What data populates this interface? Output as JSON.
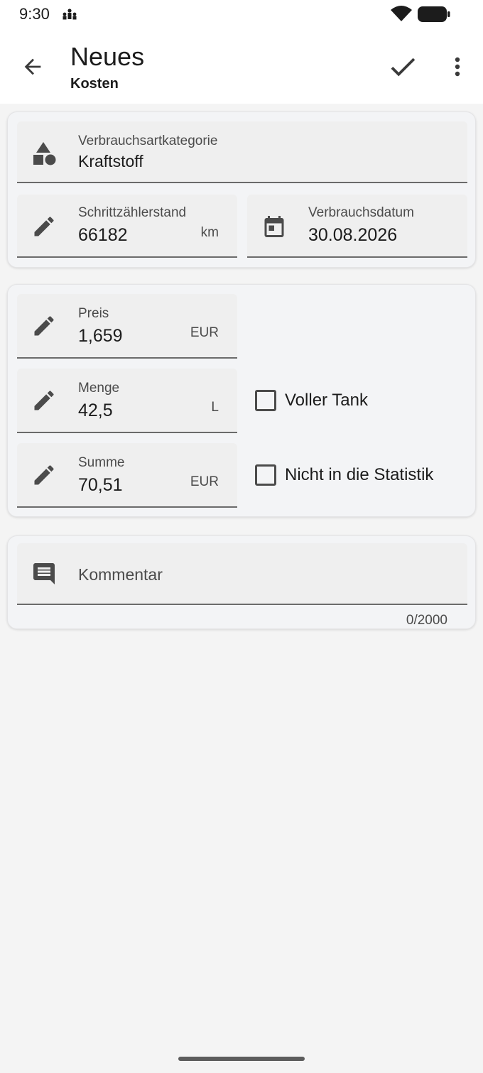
{
  "status_bar": {
    "time": "9:30"
  },
  "app_bar": {
    "title": "Neues",
    "subtitle": "Kosten"
  },
  "card1": {
    "category": {
      "label": "Verbrauchsartkategorie",
      "value": "Kraftstoff"
    },
    "odometer": {
      "label": "Schrittzählerstand",
      "value": "66182",
      "unit": "km"
    },
    "date": {
      "label": "Verbrauchsdatum",
      "value": "30.08.2026"
    }
  },
  "card2": {
    "price": {
      "label": "Preis",
      "value": "1,659",
      "unit": "EUR"
    },
    "quantity": {
      "label": "Menge",
      "value": "42,5",
      "unit": "L"
    },
    "total": {
      "label": "Summe",
      "value": "70,51",
      "unit": "EUR"
    },
    "full_tank": {
      "label": "Voller Tank",
      "checked": false
    },
    "exclude_stats": {
      "label": "Nicht in die Statistik",
      "checked": false
    }
  },
  "card3": {
    "comment": {
      "placeholder": "Kommentar",
      "counter": "0/2000"
    }
  },
  "colors": {
    "icon": "#4b4b4b",
    "surface": "#f3f4f6",
    "field": "#efefef"
  }
}
